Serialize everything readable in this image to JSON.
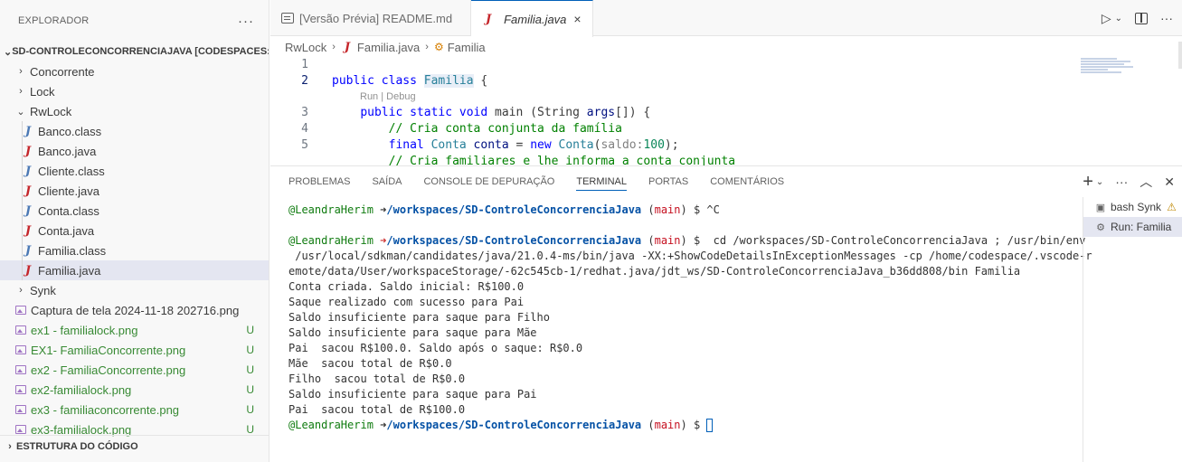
{
  "sidebar": {
    "title": "EXPLORADOR",
    "more": "···",
    "workspace": "SD-CONTROLECONCORRENCIAJAVA [CODESPACES: ...",
    "items": [
      {
        "label": "Concorrente",
        "kind": "folder",
        "chevron": "›"
      },
      {
        "label": "Lock",
        "kind": "folder",
        "chevron": "›"
      },
      {
        "label": "RwLock",
        "kind": "folder-open",
        "chevron": "⌄"
      },
      {
        "label": "Banco.class",
        "kind": "class"
      },
      {
        "label": "Banco.java",
        "kind": "java"
      },
      {
        "label": "Cliente.class",
        "kind": "class"
      },
      {
        "label": "Cliente.java",
        "kind": "java"
      },
      {
        "label": "Conta.class",
        "kind": "class"
      },
      {
        "label": "Conta.java",
        "kind": "java"
      },
      {
        "label": "Familia.class",
        "kind": "class"
      },
      {
        "label": "Familia.java",
        "kind": "java"
      },
      {
        "label": "Synk",
        "kind": "folder",
        "chevron": "›"
      },
      {
        "label": "Captura de tela 2024-11-18 202716.png",
        "kind": "image"
      },
      {
        "label": "ex1 - familialock.png",
        "kind": "image",
        "badge": "U"
      },
      {
        "label": "EX1- FamiliaConcorrente.png",
        "kind": "image",
        "badge": "U"
      },
      {
        "label": "ex2 - FamiliaConcorrente.png",
        "kind": "image",
        "badge": "U"
      },
      {
        "label": "ex2-familialock.png",
        "kind": "image",
        "badge": "U"
      },
      {
        "label": "ex3 - familiaconcorrente.png",
        "kind": "image",
        "badge": "U"
      },
      {
        "label": "ex3-familialock.png",
        "kind": "image",
        "badge": "U"
      }
    ],
    "outline": "ESTRUTURA DO CÓDIGO"
  },
  "tabs": [
    {
      "label": "[Versão Prévia] README.md",
      "active": false
    },
    {
      "label": "Familia.java",
      "active": true,
      "close": "×"
    }
  ],
  "breadcrumb": {
    "folder": "RwLock",
    "file": "Familia.java",
    "symbol": "Familia"
  },
  "code": {
    "line_numbers": [
      "1",
      "2",
      "3",
      "4",
      "5"
    ],
    "codelens": "Run | Debug",
    "line2": {
      "kw1": "public",
      "kw2": "class",
      "name": "Familia",
      "rest": " {"
    },
    "line3": {
      "kw": "public static void",
      "name": " main ",
      "rest": "(String ",
      "arg": "args",
      "end": "[]) {"
    },
    "line4": "// Cria conta conjunta da família",
    "line5": {
      "kw": "final",
      "type": " Conta",
      "var": " conta",
      "eq": " = ",
      "new": "new",
      "cls": " Conta",
      "open": "(",
      "hint": "saldo:",
      "num": "100",
      "close": ");"
    },
    "line6": "// Cria familiares e lhe informa a conta conjunta"
  },
  "panel": {
    "tabs": [
      "PROBLEMAS",
      "SAÍDA",
      "CONSOLE DE DEPURAÇÃO",
      "TERMINAL",
      "PORTAS",
      "COMENTÁRIOS"
    ],
    "active_tab": "TERMINAL"
  },
  "terminal": {
    "user": "@LeandraHerim",
    "arrow": "➜",
    "path": "/workspaces/SD-ControleConcorrenciaJava",
    "branch_open": " (",
    "branch": "main",
    "branch_close": ") $ ",
    "cmd1": "^C",
    "cmd2": " cd /workspaces/SD-ControleConcorrenciaJava ; /usr/bin/env",
    "cont1": " /usr/local/sdkman/candidates/java/21.0.4-ms/bin/java -XX:+ShowCodeDetailsInExceptionMessages -cp /home/codespace/.vscode-r",
    "cont2": "emote/data/User/workspaceStorage/-62c545cb-1/redhat.java/jdt_ws/SD-ControleConcorrenciaJava_b36dd808/bin Familia",
    "output": [
      "Conta criada. Saldo inicial: R$100.0",
      "Saque realizado com sucesso para Pai",
      "Saldo insuficiente para saque para Filho",
      "Saldo insuficiente para saque para Mãe",
      "Pai  sacou R$100.0. Saldo após o saque: R$0.0",
      "Mãe  sacou total de R$0.0",
      "Filho  sacou total de R$0.0",
      "Saldo insuficiente para saque para Pai",
      "Pai  sacou total de R$100.0"
    ]
  },
  "terminal_list": [
    {
      "label": "bash",
      "extra": "Synk",
      "warn": "⚠"
    },
    {
      "label": "Run: Familia"
    }
  ],
  "colors": {
    "accent": "#005fb8",
    "java": "#c5262b",
    "untracked": "#388a34"
  }
}
